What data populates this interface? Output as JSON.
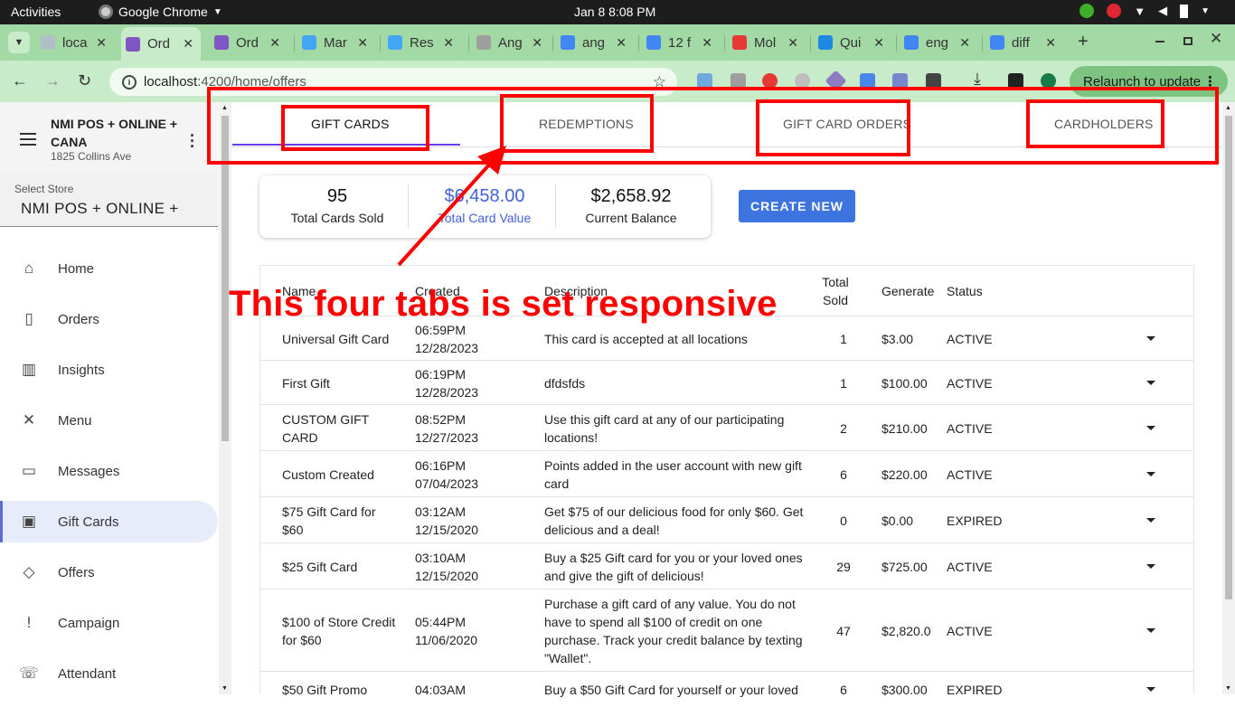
{
  "system_bar": {
    "activities": "Activities",
    "app": "Google Chrome",
    "clock": "Jan 8   8:08 PM"
  },
  "browser": {
    "tabs": [
      {
        "label": "loca",
        "color": "#b0bec5"
      },
      {
        "label": "Ord",
        "color": "#7e57c2"
      },
      {
        "label": "Ord",
        "color": "#7e57c2"
      },
      {
        "label": "Mar",
        "color": "#42a5f5"
      },
      {
        "label": "Res",
        "color": "#42a5f5"
      },
      {
        "label": "Ang",
        "color": "#9e9e9e"
      },
      {
        "label": "ang",
        "color": "#4285f4"
      },
      {
        "label": "12 f",
        "color": "#4285f4"
      },
      {
        "label": "Mol",
        "color": "#e53935"
      },
      {
        "label": "Qui",
        "color": "#1e88e5"
      },
      {
        "label": "eng",
        "color": "#4285f4"
      },
      {
        "label": "diff",
        "color": "#4285f4"
      }
    ],
    "new_tab": "+",
    "url_host": "localhost",
    "url_path": ":4200/home/offers",
    "relaunch": "Relaunch to update"
  },
  "sidebar": {
    "store_name": "NMI POS + ONLINE + CANA",
    "store_address": "1825 Collins Ave",
    "select_label": "Select Store",
    "select_value": "NMI POS + ONLINE +",
    "items": [
      {
        "label": "Home",
        "icon": "store-icon"
      },
      {
        "label": "Orders",
        "icon": "shopping-bag-icon"
      },
      {
        "label": "Insights",
        "icon": "chart-icon"
      },
      {
        "label": "Menu",
        "icon": "utensils-icon"
      },
      {
        "label": "Messages",
        "icon": "chat-icon"
      },
      {
        "label": "Gift Cards",
        "icon": "gift-card-icon",
        "active": true
      },
      {
        "label": "Offers",
        "icon": "tag-icon"
      },
      {
        "label": "Campaign",
        "icon": "announcement-icon"
      },
      {
        "label": "Attendant",
        "icon": "phone-icon"
      }
    ]
  },
  "main": {
    "tabs": [
      "GIFT CARDS",
      "REDEMPTIONS",
      "GIFT CARD ORDERS",
      "CARDHOLDERS"
    ],
    "stats": [
      {
        "value": "95",
        "label": "Total Cards Sold"
      },
      {
        "value": "$6,458.00",
        "label": "Total Card Value"
      },
      {
        "value": "$2,658.92",
        "label": "Current Balance"
      }
    ],
    "create_button": "CREATE NEW",
    "columns": [
      "Name",
      "Created",
      "Description",
      "Total Sold",
      "Generate",
      "Status"
    ],
    "rows": [
      {
        "name": "Universal Gift Card",
        "time": "06:59PM",
        "date": "12/28/2023",
        "description": "This card is accepted at all locations",
        "sold": "1",
        "generate": "$3.00",
        "status": "ACTIVE"
      },
      {
        "name": "First Gift",
        "time": "06:19PM",
        "date": "12/28/2023",
        "description": "dfdsfds",
        "sold": "1",
        "generate": "$100.00",
        "status": "ACTIVE"
      },
      {
        "name": "CUSTOM GIFT CARD",
        "time": "08:52PM",
        "date": "12/27/2023",
        "description": "Use this gift card at any of our participating locations!",
        "sold": "2",
        "generate": "$210.00",
        "status": "ACTIVE"
      },
      {
        "name": "Custom Created",
        "time": "06:16PM",
        "date": "07/04/2023",
        "description": "Points added in the user account with new gift card",
        "sold": "6",
        "generate": "$220.00",
        "status": "ACTIVE"
      },
      {
        "name": "$75 Gift Card for $60",
        "time": "03:12AM",
        "date": "12/15/2020",
        "description": "Get $75 of our delicious food for only $60. Get delicious and a deal!",
        "sold": "0",
        "generate": "$0.00",
        "status": "EXPIRED"
      },
      {
        "name": "$25 Gift Card",
        "time": "03:10AM",
        "date": "12/15/2020",
        "description": "Buy a $25 Gift card for you or your loved ones and give the gift of delicious!",
        "sold": "29",
        "generate": "$725.00",
        "status": "ACTIVE"
      },
      {
        "name": "$100 of Store Credit for $60",
        "time": "05:44PM",
        "date": "11/06/2020",
        "description": "Purchase a gift card of any value. You do not have to spend all $100 of credit on one purchase. Track your credit balance by texting \"Wallet\".",
        "sold": "47",
        "generate": "$2,820.0",
        "status": "ACTIVE"
      },
      {
        "name": "$50 Gift Promo",
        "time": "04:03AM",
        "date": "",
        "description": "Buy a $50 Gift Card for yourself or your loved",
        "sold": "6",
        "generate": "$300.00",
        "status": "EXPIRED"
      }
    ]
  },
  "annotation": {
    "text": "This four tabs is set responsive",
    "color": "#ff0000"
  }
}
